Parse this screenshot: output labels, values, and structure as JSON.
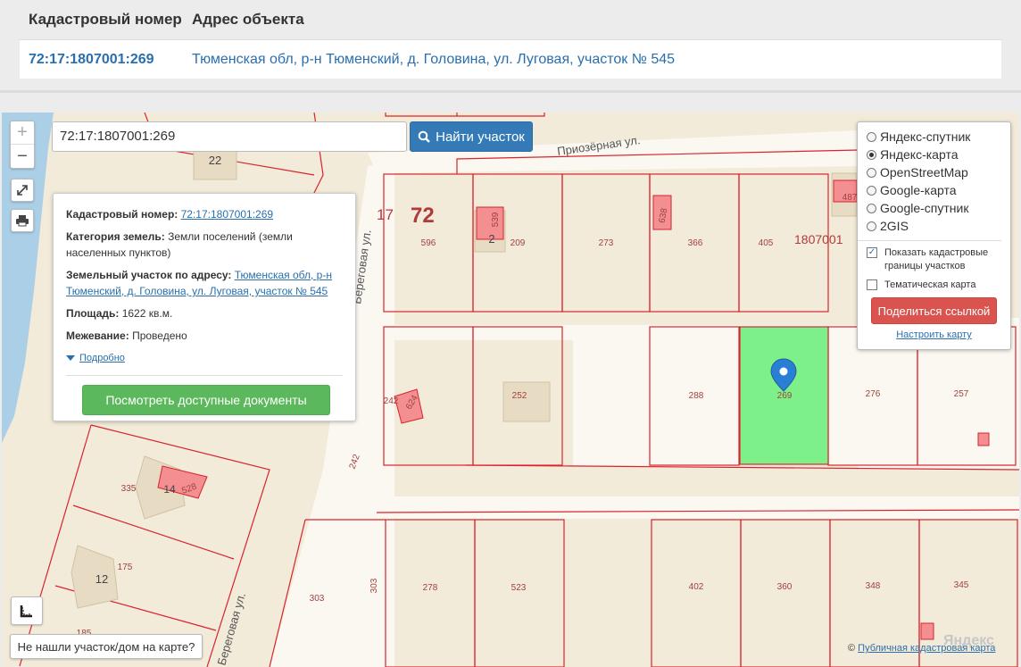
{
  "info": {
    "col_cadastre": "Кадастровый номер",
    "col_address": "Адрес объекта",
    "cadastre_value": "72:17:1807001:269",
    "address_value": "Тюменская обл, р-н Тюменский, д. Головина, ул. Луговая, участок № 545"
  },
  "search": {
    "value": "72:17:1807001:269",
    "button_label": "Найти участок"
  },
  "zoom": {
    "plus": "+",
    "minus": "−"
  },
  "popup": {
    "cadastre_label": "Кадастровый номер:",
    "cadastre_link": "72:17:1807001:269",
    "category_label": "Категория земель:",
    "category_value": "Земли поселений (земли населенных пунктов)",
    "address_label": "Земельный участок по адресу:",
    "address_link": "Тюменская обл, р-н Тюменский, д. Головина, ул. Луговая, участок № 545",
    "area_label": "Площадь:",
    "area_value": "1622 кв.м.",
    "survey_label": "Межевание:",
    "survey_value": "Проведено",
    "more_label": "Подробно",
    "docs_button": "Посмотреть доступные документы"
  },
  "layers": {
    "options": [
      {
        "label": "Яндекс-спутник",
        "selected": false
      },
      {
        "label": "Яндекс-карта",
        "selected": true
      },
      {
        "label": "OpenStreetMap",
        "selected": false
      },
      {
        "label": "Google-карта",
        "selected": false
      },
      {
        "label": "Google-спутник",
        "selected": false
      },
      {
        "label": "2GIS",
        "selected": false
      }
    ],
    "show_borders_label": "Показать кадастровые границы участков",
    "show_borders_checked": true,
    "thematic_label": "Тематическая карта",
    "thematic_checked": false,
    "share_button": "Поделиться ссылкой",
    "tune_link": "Настроить карту"
  },
  "map_labels": {
    "street_priozernaya": "Приозёрная ул.",
    "street_beregovaya": "Береговая ул.",
    "street_beregovaya_2": "Береговая ул.",
    "region_code": "72",
    "district_code": "17",
    "block_code": "1807001",
    "parcels": [
      "22",
      "596",
      "539",
      "2",
      "209",
      "273",
      "638",
      "366",
      "405",
      "487",
      "242",
      "624",
      "252",
      "288",
      "269",
      "276",
      "257",
      "242",
      "335",
      "14",
      "528",
      "175",
      "12",
      "185",
      "303",
      "303",
      "278",
      "523",
      "402",
      "360",
      "348",
      "345"
    ]
  },
  "notfound_label": "Не нашли участок/дом на карте?",
  "copyright_prefix": "©",
  "copyright_link": "Публичная кадастровая карта",
  "yandex_logo": "Яндекс",
  "colors": {
    "selected_parcel": "#7ef08a",
    "parcel_border": "#d9232e",
    "building": "#f38f91",
    "water": "#aacfe6",
    "primary": "#337ab7",
    "success": "#5cb85c",
    "danger": "#d9534f"
  }
}
